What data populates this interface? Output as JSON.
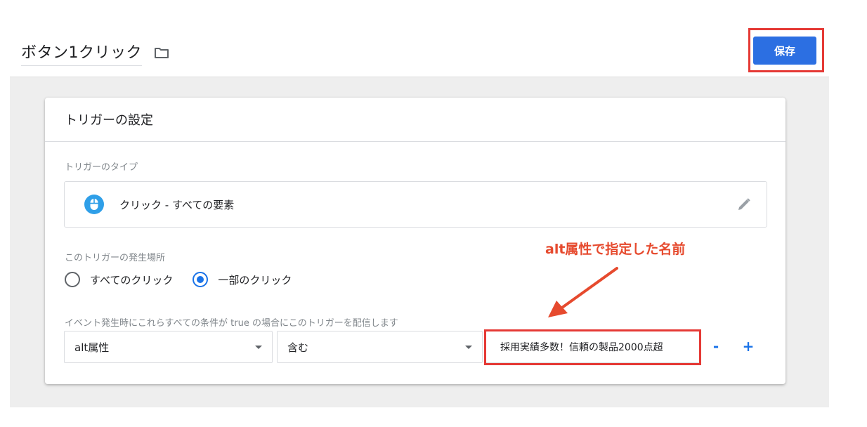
{
  "header": {
    "title": "ボタン1クリック",
    "folder_icon": "folder-icon",
    "save_label": "保存"
  },
  "card": {
    "title": "トリガーの設定",
    "type_section": {
      "label": "トリガーのタイプ",
      "icon": "mouse-icon",
      "value": "クリック - すべての要素",
      "edit_icon": "pencil-icon"
    },
    "fire_on": {
      "label": "このトリガーの発生場所",
      "options": [
        {
          "label": "すべてのクリック",
          "selected": false
        },
        {
          "label": "一部のクリック",
          "selected": true
        }
      ]
    },
    "condition": {
      "label": "イベント発生時にこれらすべての条件が true の場合にこのトリガーを配信します",
      "variable": "alt属性",
      "operator": "含む",
      "value": "採用実績多数！信頼の製品2000点超",
      "remove_label": "-",
      "add_label": "+"
    }
  },
  "annotation": {
    "text": "alt属性で指定した名前"
  },
  "colors": {
    "accent": "#1a73e8",
    "save_button": "#2c6fe2",
    "annotation": "#e64a2e",
    "highlight_box": "#e53935"
  }
}
